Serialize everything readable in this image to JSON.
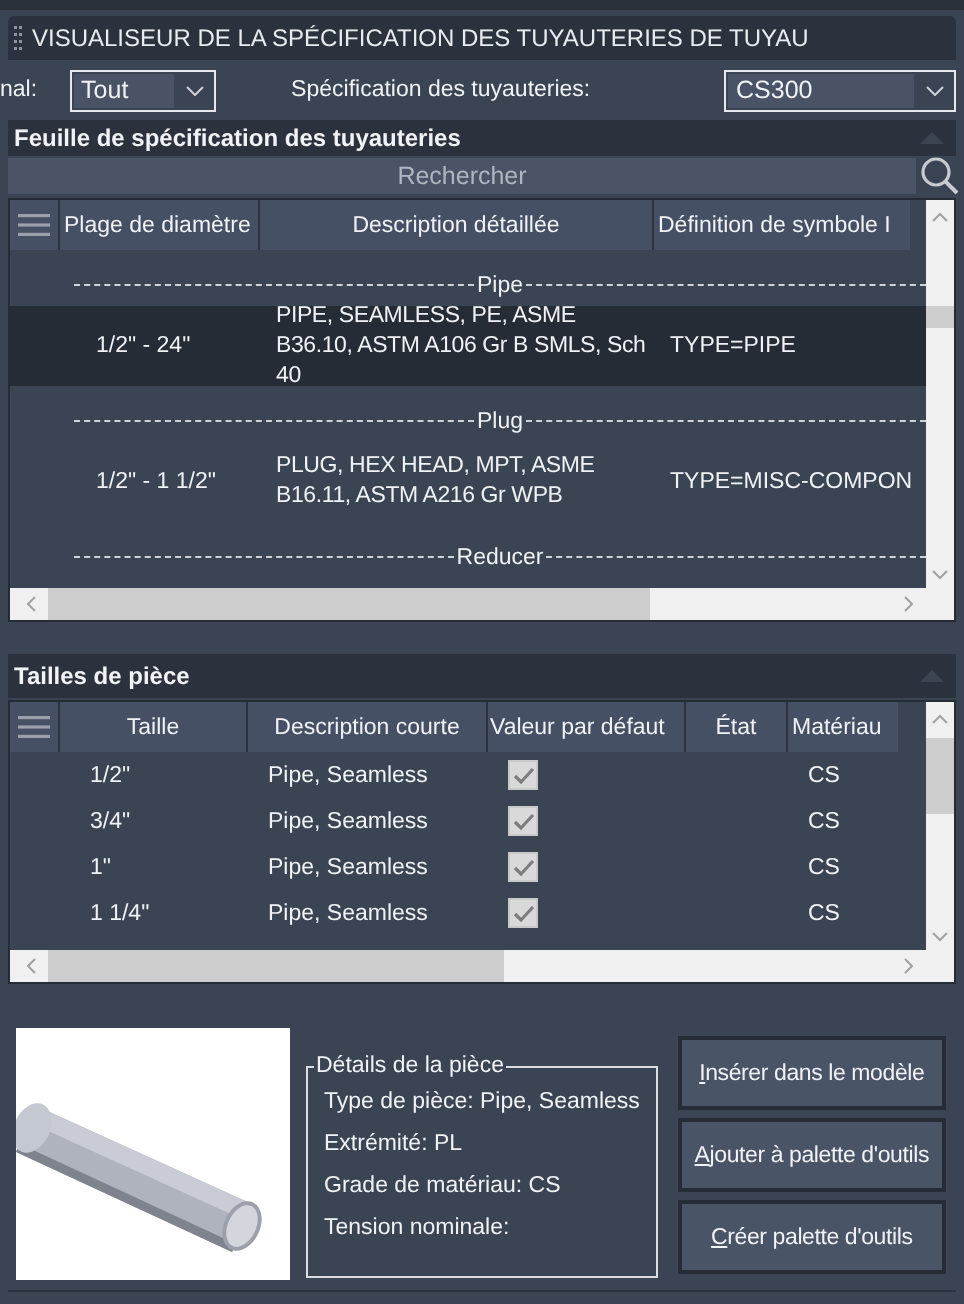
{
  "window": {
    "title": "VISUALISEUR DE LA SPÉCIFICATION DES TUYAUTERIES DE TUYAU"
  },
  "filters": {
    "label_1": "nal:",
    "select_1": "Tout",
    "label_2": "Spécification des tuyauteries:",
    "select_2": "CS300"
  },
  "spec_sheet": {
    "title": "Feuille de spécification des tuyauteries",
    "search": {
      "placeholder": "Rechercher"
    },
    "columns": [
      "Plage de diamètre",
      "Description détaillée",
      "Définition de symbole I"
    ],
    "rows": [
      {
        "kind": "group",
        "label": "Pipe"
      },
      {
        "kind": "item",
        "selected": true,
        "range": "1/2\" - 24\"",
        "description": "PIPE, SEAMLESS, PE, ASME B36.10, ASTM A106 Gr B SMLS, Sch 40",
        "symbol": "TYPE=PIPE"
      },
      {
        "kind": "group",
        "label": "Plug"
      },
      {
        "kind": "item",
        "selected": false,
        "range": "1/2\" - 1 1/2\"",
        "description": "PLUG, HEX HEAD, MPT, ASME B16.11, ASTM A216 Gr WPB",
        "symbol": "TYPE=MISC-COMPON"
      },
      {
        "kind": "group",
        "label": "Reducer"
      }
    ]
  },
  "part_sizes": {
    "title": "Tailles de pièce",
    "columns": [
      "Taille",
      "Description courte",
      "Valeur par défaut",
      "État",
      "Matériau"
    ],
    "rows": [
      {
        "size": "1/2\"",
        "description": "Pipe, Seamless",
        "checked": true,
        "material": "CS"
      },
      {
        "size": "3/4\"",
        "description": "Pipe, Seamless",
        "checked": true,
        "material": "CS"
      },
      {
        "size": "1\"",
        "description": "Pipe, Seamless",
        "checked": true,
        "material": "CS"
      },
      {
        "size": "1 1/4\"",
        "description": "Pipe, Seamless",
        "checked": true,
        "material": "CS"
      }
    ]
  },
  "details": {
    "title": "Détails de la pièce",
    "lines": [
      "Type de pièce: Pipe, Seamless",
      "Extrémité: PL",
      "Grade de matériau: CS",
      "Tension nominale:"
    ]
  },
  "buttons": [
    "Insérer dans le modèle",
    "Ajouter à palette d'outils",
    "Créer palette d'outils"
  ]
}
